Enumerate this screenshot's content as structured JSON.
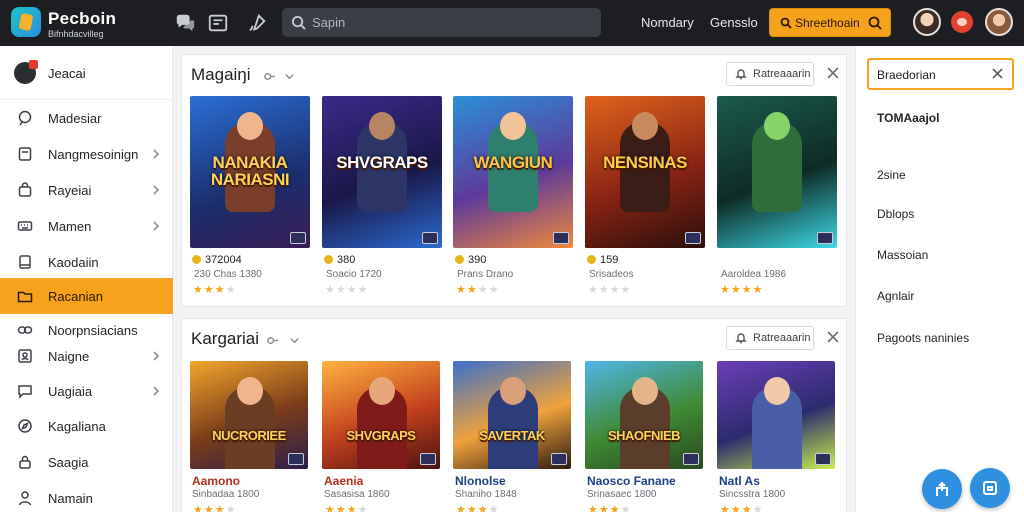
{
  "topbar": {
    "brand": "Pecboin",
    "brand_sub": "Bifnhdacvilleg",
    "search_placeholder": "Sapin",
    "nav_links": [
      "Nomdary",
      "Gensslo"
    ],
    "cta_label": "Shreethoain"
  },
  "sidebar": {
    "header": "Jeacai",
    "items": [
      {
        "label": "Madesiar",
        "icon": "chat-icon",
        "chevron": false,
        "active": false
      },
      {
        "label": "Nangmesoinign",
        "icon": "document-icon",
        "chevron": true,
        "active": false
      },
      {
        "label": "Rayeiai",
        "icon": "bag-icon",
        "chevron": true,
        "active": false
      },
      {
        "label": "Mamen",
        "icon": "keyboard-icon",
        "chevron": true,
        "active": false
      },
      {
        "label": "Kaodaiin",
        "icon": "notebook-icon",
        "chevron": false,
        "active": false
      },
      {
        "label": "Racanian",
        "icon": "folder-icon",
        "chevron": false,
        "active": true
      },
      {
        "label": "Noorpnsiacians",
        "icon": "link-icon",
        "chevron": false,
        "active": false
      },
      {
        "label": "Naigne",
        "icon": "user-box-icon",
        "chevron": true,
        "active": false
      },
      {
        "label": "Uagiaia",
        "icon": "chat-bubble-icon",
        "chevron": true,
        "active": false
      },
      {
        "label": "Kagaliana",
        "icon": "compass-icon",
        "chevron": false,
        "active": false
      },
      {
        "label": "Saagia",
        "icon": "lock-icon",
        "chevron": false,
        "active": false
      },
      {
        "label": "Namain",
        "icon": "person-icon",
        "chevron": false,
        "active": false
      }
    ]
  },
  "section1": {
    "title": "Magaiŋi",
    "button_label": "Ratreaaarin",
    "cards": [
      {
        "cover_title": "NANAKIA NARIASNI",
        "meta1": "372004",
        "meta2": "230 Chas 1380",
        "stars": 3
      },
      {
        "cover_title": "SHVGRAPS",
        "meta1": "380",
        "meta2": "Soacio 1720",
        "stars": 0
      },
      {
        "cover_title": "WANGIUN",
        "meta1": "390",
        "meta2": "Prans Drano",
        "stars": 2
      },
      {
        "cover_title": "NENSINAS",
        "meta1": "159",
        "meta2": "Srisadeos",
        "stars": 0
      },
      {
        "cover_title": "",
        "meta1": "",
        "meta2": "Aaroldea 1986",
        "stars": 4
      }
    ]
  },
  "section2": {
    "title": "Kargariai",
    "button_label": "Ratreaaarin",
    "cards": [
      {
        "cover_title": "NUCRORIEE",
        "name": "Aamono",
        "sub": "Sinbadaa 1800",
        "stars": 3,
        "blue": false
      },
      {
        "cover_title": "SHVGRAPS",
        "name": "Aaenia",
        "sub": "Sasasisa 1860",
        "stars": 3,
        "blue": false
      },
      {
        "cover_title": "SAVERTAK",
        "name": "Nlonolse",
        "sub": "Shaniho 1848",
        "stars": 3,
        "blue": true
      },
      {
        "cover_title": "SHAOFNIEB",
        "name": "Naosco Fanane",
        "sub": "Srinasaec 1800",
        "stars": 3,
        "blue": true
      },
      {
        "cover_title": "",
        "name": "Natl As",
        "sub": "Sincsstra 1800",
        "stars": 3,
        "blue": true
      }
    ]
  },
  "rightpanel": {
    "field_value": "Braedorian",
    "items": [
      "TOMAaajol",
      "2sine",
      "Dblops",
      "Massoian",
      "Agnlair",
      "Pagoots naninies"
    ]
  },
  "colors": {
    "accent": "#f6a21c",
    "topbar": "#1c1e22",
    "fab": "#2f8fe0"
  }
}
